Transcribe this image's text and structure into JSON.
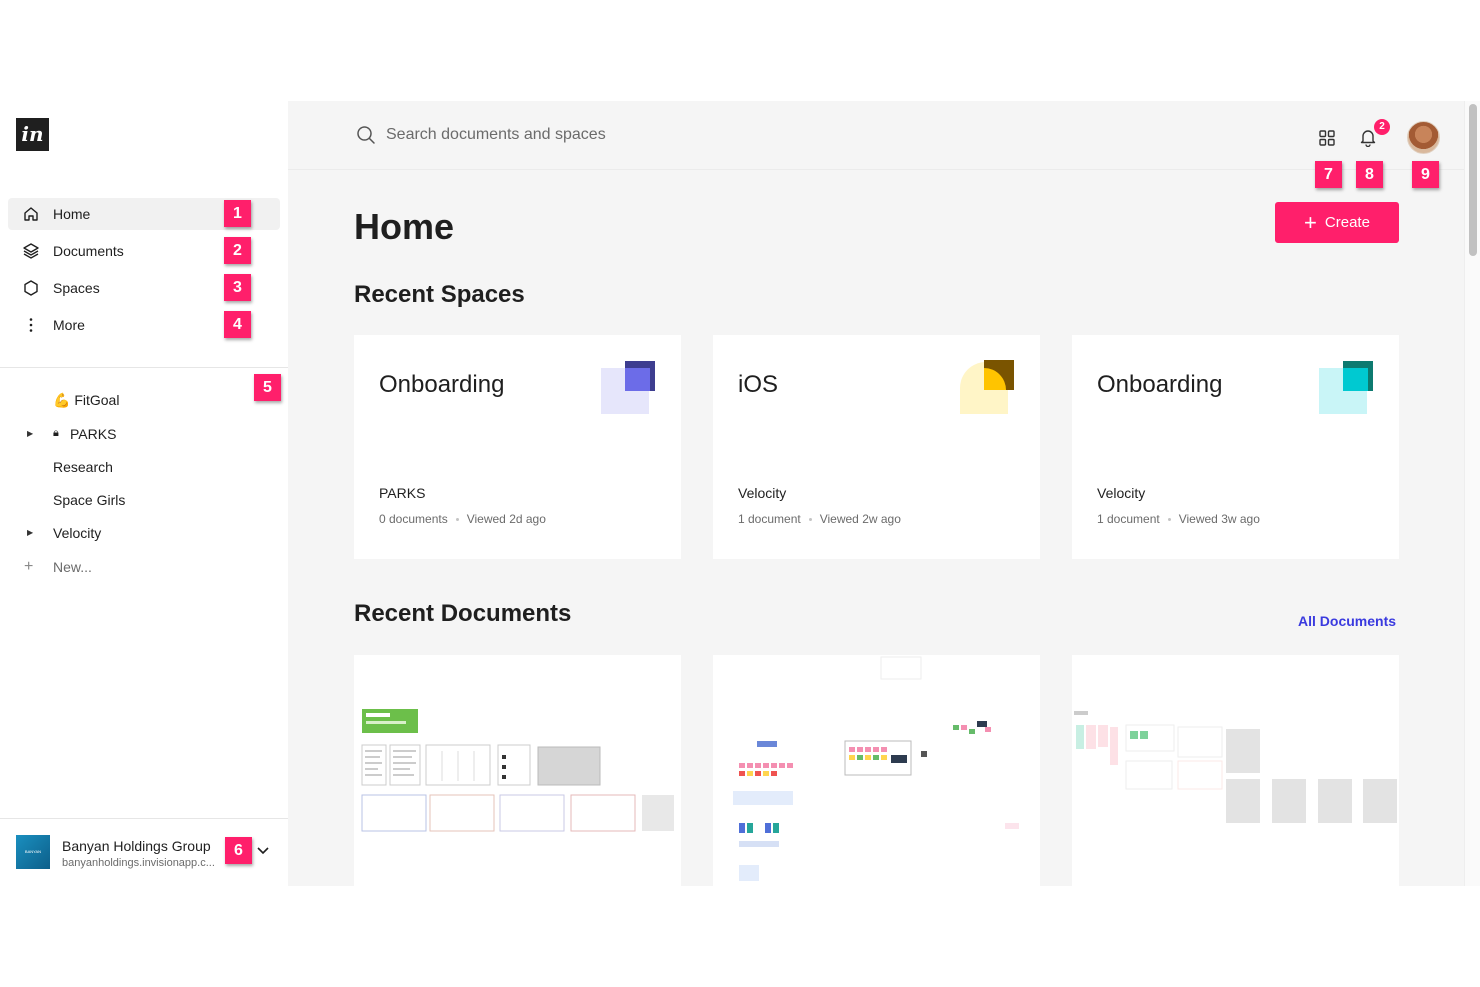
{
  "app": {
    "logo_text": "in"
  },
  "sidebar": {
    "nav": [
      {
        "label": "Home",
        "icon": "home-icon",
        "badge": "1"
      },
      {
        "label": "Documents",
        "icon": "layers-icon",
        "badge": "2"
      },
      {
        "label": "Spaces",
        "icon": "hexagon-icon",
        "badge": "3"
      },
      {
        "label": "More",
        "icon": "more-vertical-icon",
        "badge": "4"
      }
    ],
    "spaces_badge": "5",
    "spaces": [
      {
        "name": "💪 FitGoal",
        "expandable": false,
        "locked": false
      },
      {
        "name": "PARKS",
        "expandable": true,
        "locked": true
      },
      {
        "name": "Research",
        "expandable": false,
        "locked": false
      },
      {
        "name": "Space Girls",
        "expandable": false,
        "locked": false
      },
      {
        "name": "Velocity",
        "expandable": true,
        "locked": false
      }
    ],
    "new_label": "New...",
    "org": {
      "logo_text": "BANYAN",
      "name": "Banyan Holdings Group",
      "url": "banyanholdings.invisionapp.c...",
      "badge": "6"
    }
  },
  "topbar": {
    "search_placeholder": "Search documents and spaces",
    "apps_badge": "7",
    "notifications_badge": "8",
    "notifications_count": "2",
    "avatar_badge": "9"
  },
  "main": {
    "title": "Home",
    "create_label": "Create",
    "recent_spaces_title": "Recent Spaces",
    "recent_documents_title": "Recent Documents",
    "all_documents_label": "All Documents",
    "space_cards": [
      {
        "title": "Onboarding",
        "owner": "PARKS",
        "docs": "0 documents",
        "viewed": "Viewed 2d ago",
        "back_color": "#e6e6fb",
        "front_color": "#6c6ce8",
        "edge_color": "#3d3d8f",
        "shape": "square"
      },
      {
        "title": "iOS",
        "owner": "Velocity",
        "docs": "1 document",
        "viewed": "Viewed 2w ago",
        "back_color": "#fff5c7",
        "front_color": "#ffc400",
        "edge_color": "#7a5400",
        "shape": "round"
      },
      {
        "title": "Onboarding",
        "owner": "Velocity",
        "docs": "1 document",
        "viewed": "Viewed 3w ago",
        "back_color": "#c9f5f7",
        "front_color": "#00c9d1",
        "edge_color": "#0d7a70",
        "shape": "square"
      }
    ]
  },
  "colors": {
    "accent": "#ff1f6b",
    "link": "#3a3adf",
    "badge": "#ff1f6b"
  }
}
